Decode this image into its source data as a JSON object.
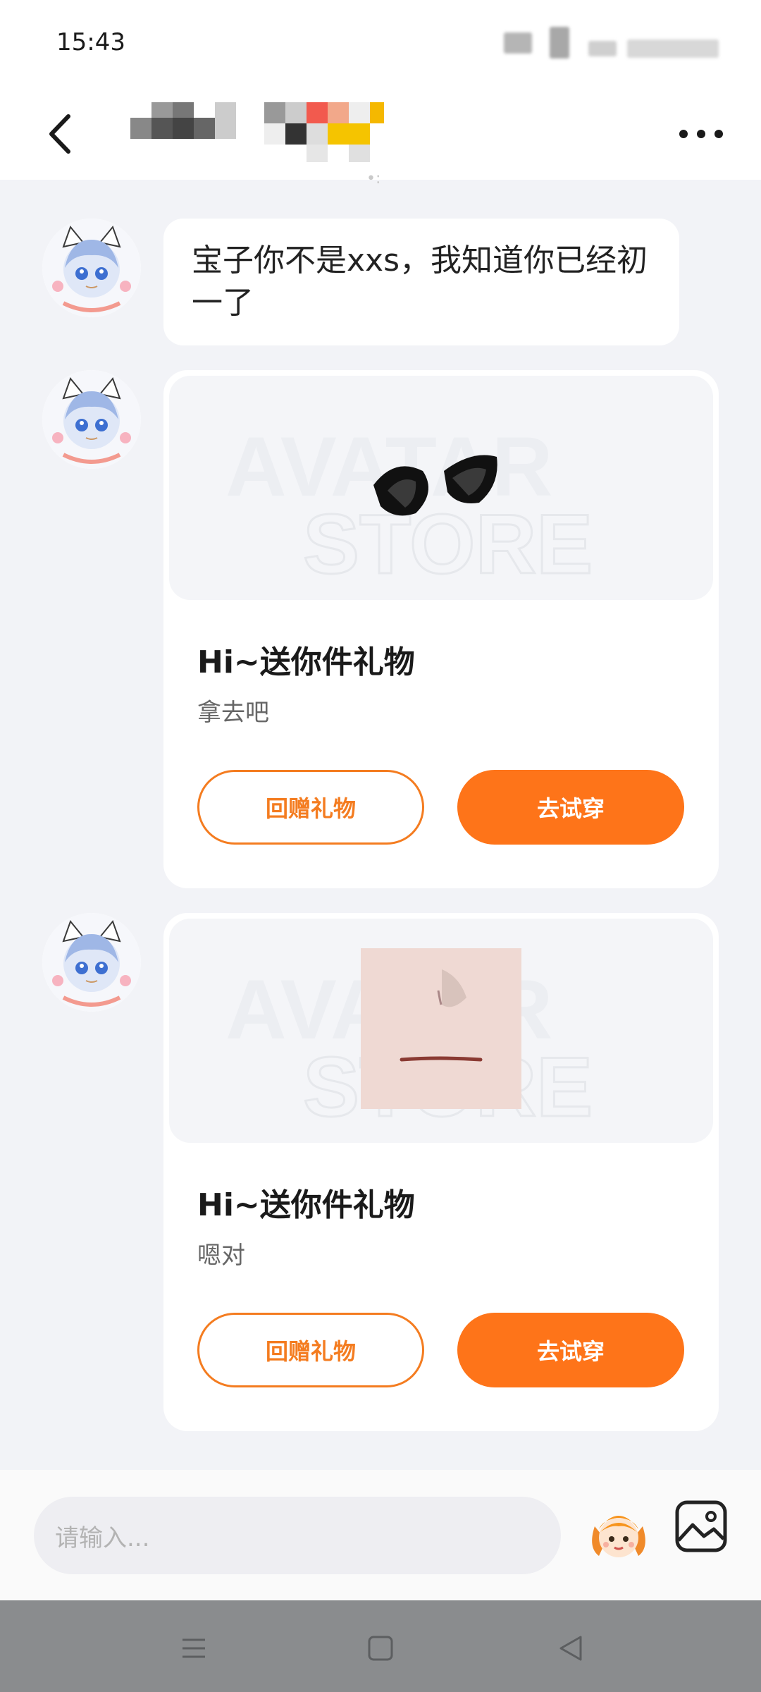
{
  "status_bar": {
    "time": "15:43"
  },
  "header": {
    "contact_name": ""
  },
  "messages": [
    {
      "type": "text",
      "text": "宝子你不是xxs，我知道你已经初一了"
    },
    {
      "type": "gift",
      "item_icon": "cat-ears-icon",
      "watermark_line1": "AVATAR",
      "watermark_line2": "STORE",
      "title": "Hi~送你件礼物",
      "message": "拿去吧",
      "return_label": "回赠礼物",
      "tryon_label": "去试穿"
    },
    {
      "type": "gift",
      "item_icon": "face-item-icon",
      "watermark_line1": "AVATAR",
      "watermark_line2": "STORE",
      "title": "Hi~送你件礼物",
      "message": "嗯对",
      "return_label": "回赠礼物",
      "tryon_label": "去试穿"
    }
  ],
  "input": {
    "placeholder": "请输入..."
  },
  "colors": {
    "accent": "#fe7419",
    "background": "#f2f3f7"
  }
}
